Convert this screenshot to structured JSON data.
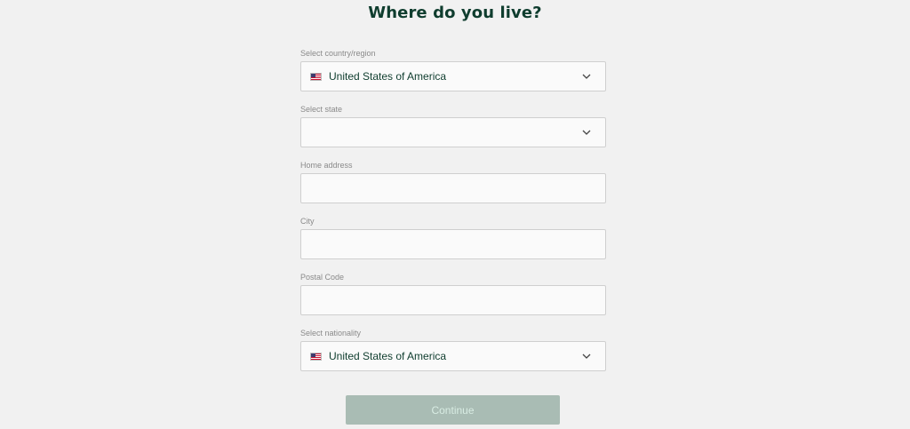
{
  "page": {
    "title": "Where do you live?"
  },
  "fields": {
    "country": {
      "label": "Select country/region",
      "value": "United States of America",
      "flag_icon": "us-flag-icon"
    },
    "state": {
      "label": "Select state",
      "value": ""
    },
    "address": {
      "label": "Home address",
      "value": "",
      "placeholder": ""
    },
    "city": {
      "label": "City",
      "value": "",
      "placeholder": ""
    },
    "postal": {
      "label": "Postal Code",
      "value": "",
      "placeholder": ""
    },
    "nationality": {
      "label": "Select nationality",
      "value": "United States of America",
      "flag_icon": "us-flag-icon"
    }
  },
  "actions": {
    "continue_label": "Continue"
  },
  "colors": {
    "background": "#f1f1f1",
    "heading": "#0f3d2e",
    "button_disabled": "#a9bcb4",
    "button_text": "#d8ece3"
  }
}
